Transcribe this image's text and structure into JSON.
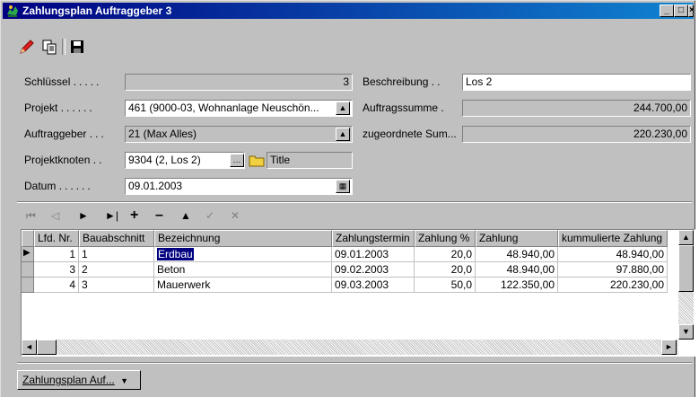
{
  "window": {
    "title": "Zahlungsplan Auftraggeber 3",
    "controls": [
      "_",
      "□",
      "×"
    ]
  },
  "toolbar": {
    "icons": [
      "pencil-icon",
      "copy-icon",
      "save-icon"
    ]
  },
  "form": {
    "left": [
      {
        "label": "Schlüssel",
        "value": "3"
      },
      {
        "label": "Projekt",
        "value": "461 (9000-03, Wohnanlage Neuschön..."
      },
      {
        "label": "Auftraggeber",
        "value": "21 (Max Alles)"
      },
      {
        "label": "Projektknoten",
        "value": "9304 (2, Los 2)",
        "extra": "Title"
      },
      {
        "label": "Datum",
        "value": "09.01.2003"
      }
    ],
    "right": [
      {
        "label": "Beschreibung",
        "value": "Los 2"
      },
      {
        "label": "Auftragssumme",
        "value": "244.700,00"
      },
      {
        "label": "zugeordnete Sum...",
        "value": "220.230,00"
      }
    ]
  },
  "nav": {
    "buttons": [
      "first",
      "prior",
      "next",
      "last",
      "insert",
      "delete",
      "edit",
      "post",
      "cancel"
    ]
  },
  "grid": {
    "columns": [
      "Lfd. Nr.",
      "Bauabschnitt",
      "Bezeichnung",
      "Zahlungstermin",
      "Zahlung %",
      "Zahlung",
      "kummulierte Zahlung"
    ],
    "rows": [
      [
        "1",
        "1",
        "Erdbau",
        "09.01.2003",
        "20,0",
        "48.940,00",
        "48.940,00"
      ],
      [
        "3",
        "2",
        "Beton",
        "09.02.2003",
        "20,0",
        "48.940,00",
        "97.880,00"
      ],
      [
        "4",
        "3",
        "Mauerwerk",
        "09.03.2003",
        "50,0",
        "122.350,00",
        "220.230,00"
      ]
    ]
  },
  "bottom": {
    "button_label": "Zahlungsplan Auf..."
  },
  "colors": {
    "title_start": "#000080",
    "title_end": "#1084d0",
    "face": "#c0c0c0",
    "selection": "#000080"
  }
}
